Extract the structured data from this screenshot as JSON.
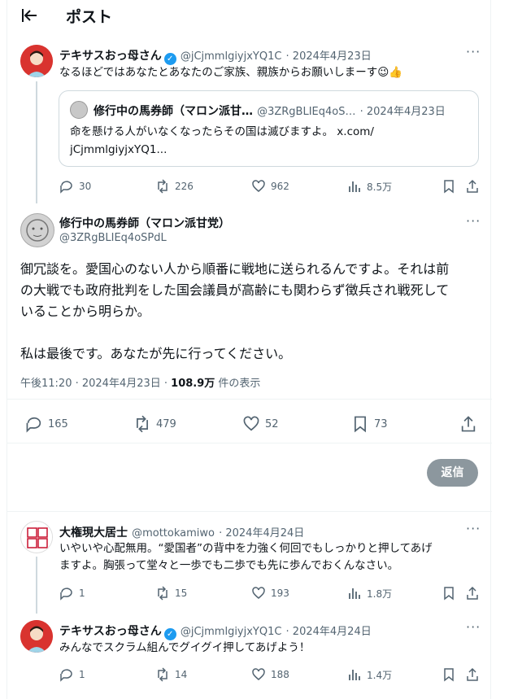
{
  "header": {
    "title": "ポスト"
  },
  "tweet1": {
    "name": "テキサスおっ母さん",
    "handle": "@jCjmmlgiyjxYQ1C",
    "date": "· 2024年4月23日",
    "text": "なるほどではあなたとあなたのご家族、親族からお願いしまーす😉👍",
    "quote": {
      "name": "修行中の馬券師（マロン派甘…",
      "handle": "@3ZRgBLIEq4oS…",
      "date": "· 2024年4月23日",
      "text1": "命を懸ける人がいなくなったらその国は滅びますよ。 x.com/",
      "text2": "jCjmmlgiyjxYQ1..."
    },
    "stats": {
      "replies": "30",
      "retweets": "226",
      "likes": "962",
      "views": "8.5万"
    }
  },
  "main": {
    "name": "修行中の馬券師（マロン派甘党）",
    "handle": "@3ZRgBLIEq4oSPdL",
    "line1": "御冗談を。愛国心のない人から順番に戦地に送られるんですよ。それは前",
    "line2": "の大戦でも政府批判をした国会議員が高齢にも関わらず徴兵され戦死して",
    "line3": "いることから明らか。",
    "line4": "私は最後です。あなたが先に行ってください。",
    "meta_time": "午後11:20 · 2024年4月23日 · ",
    "meta_views": "108.9万",
    "meta_suffix": " 件の表示",
    "stats": {
      "replies": "165",
      "retweets": "479",
      "likes": "52",
      "bookmarks": "73"
    }
  },
  "reply_button": "返信",
  "reply1": {
    "name": "大権現大居士",
    "handle": "@mottokamiwo",
    "date": "· 2024年4月24日",
    "line1": "いやいや心配無用。“愛国者”の背中を力強く何回でもしっかりと押してあげ",
    "line2": "ますよ。胸張って堂々と一歩でも二歩でも先に歩んでおくんなさい。",
    "stats": {
      "replies": "1",
      "retweets": "15",
      "likes": "193",
      "views": "1.8万"
    }
  },
  "reply2": {
    "name": "テキサスおっ母さん",
    "handle": "@jCjmmlgiyjxYQ1C",
    "date": "· 2024年4月24日",
    "text": "みんなでスクラム組んでグイグイ押してあげよう！",
    "stats": {
      "replies": "1",
      "retweets": "14",
      "likes": "188",
      "views": "1.4万"
    }
  },
  "colors": {
    "accent": "#1d9bf0",
    "muted": "#536471",
    "border": "#cfd9de"
  }
}
